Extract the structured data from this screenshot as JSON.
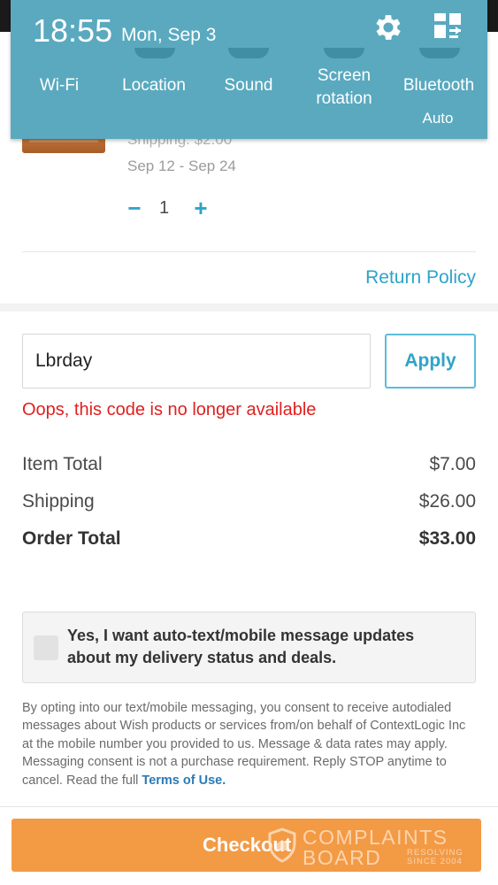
{
  "status_shade": {
    "time": "18:55",
    "date": "Mon, Sep 3",
    "tiles": [
      {
        "label": "Wi-Fi"
      },
      {
        "label": "Location"
      },
      {
        "label": "Sound"
      },
      {
        "label": "Screen rotation"
      },
      {
        "label": "Bluetooth"
      }
    ],
    "sub_label": "Auto"
  },
  "cart_item": {
    "shipping": "Shipping: $2.00",
    "dates": "Sep 12 - Sep 24",
    "quantity": "1",
    "minus_symbol": "−",
    "plus_symbol": "+"
  },
  "return_policy_label": "Return Policy",
  "promo": {
    "code_value": "Lbrday",
    "apply_label": "Apply",
    "error": "Oops, this code is no longer available"
  },
  "summary": {
    "item_total_label": "Item Total",
    "item_total_value": "$7.00",
    "shipping_label": "Shipping",
    "shipping_value": "$26.00",
    "order_total_label": "Order Total",
    "order_total_value": "$33.00"
  },
  "sms_optin": {
    "checked": false,
    "text": "Yes, I want auto-text/mobile message updates about my delivery status and deals.",
    "disclaimer": "By opting into our text/mobile messaging, you consent to receive autodialed messages about Wish products or services from/on behalf of ContextLogic Inc at the mobile number you provided to us. Message & data rates may apply. Messaging consent is not a purchase requirement. Reply STOP anytime to cancel. Read the full",
    "terms_link": "Terms of Use."
  },
  "checkout_label": "Checkout",
  "watermark": {
    "line1": "COMPLAINTS",
    "line2": "BOARD",
    "side1": "RESOLVING",
    "side2": "SINCE 2004"
  },
  "colors": {
    "accent_blue": "#2fa3c8",
    "checkout_orange": "#f39a45",
    "error_red": "#e02020",
    "shade_teal": "#5aa9bf"
  },
  "icons": [
    "settings-icon",
    "edit-quick-settings-icon",
    "shield-icon"
  ]
}
